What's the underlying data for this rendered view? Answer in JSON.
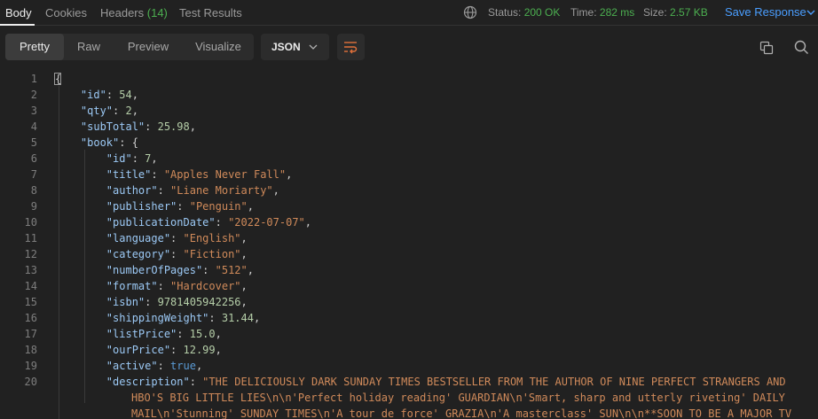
{
  "tabs": {
    "body": "Body",
    "cookies": "Cookies",
    "headers": "Headers",
    "headers_count": "(14)",
    "test_results": "Test Results"
  },
  "status": {
    "status_label": "Status:",
    "status_value": "200 OK",
    "time_label": "Time:",
    "time_value": "282 ms",
    "size_label": "Size:",
    "size_value": "2.57 KB"
  },
  "save_response": "Save Response",
  "views": {
    "pretty": "Pretty",
    "raw": "Raw",
    "preview": "Preview",
    "visualize": "Visualize"
  },
  "format": "JSON",
  "icons": {
    "globe": "globe-icon",
    "chevron": "chevron-down-icon",
    "wrap": "wrap-lines-icon",
    "copy": "copy-icon",
    "search": "search-icon"
  },
  "colors": {
    "accent": "#4a9eff",
    "success": "#4caf50",
    "key": "#9cc9f5",
    "string": "#d08a5a",
    "number": "#b5cea8",
    "boolean": "#5a9bd5"
  },
  "code": {
    "line_numbers": [
      "1",
      "2",
      "3",
      "4",
      "5",
      "6",
      "7",
      "8",
      "9",
      "10",
      "11",
      "12",
      "13",
      "14",
      "15",
      "16",
      "17",
      "18",
      "19",
      "20"
    ],
    "lines": [
      {
        "indent": "",
        "open": "{"
      },
      {
        "indent": "    ",
        "key": "\"id\"",
        "value": "54",
        "type": "n",
        "comma": ","
      },
      {
        "indent": "    ",
        "key": "\"qty\"",
        "value": "2",
        "type": "n",
        "comma": ","
      },
      {
        "indent": "    ",
        "key": "\"subTotal\"",
        "value": "25.98",
        "type": "n",
        "comma": ","
      },
      {
        "indent": "    ",
        "key": "\"book\"",
        "open": "{"
      },
      {
        "indent": "        ",
        "key": "\"id\"",
        "value": "7",
        "type": "n",
        "comma": ","
      },
      {
        "indent": "        ",
        "key": "\"title\"",
        "value": "\"Apples Never Fall\"",
        "type": "s",
        "comma": ","
      },
      {
        "indent": "        ",
        "key": "\"author\"",
        "value": "\"Liane Moriarty\"",
        "type": "s",
        "comma": ","
      },
      {
        "indent": "        ",
        "key": "\"publisher\"",
        "value": "\"Penguin\"",
        "type": "s",
        "comma": ","
      },
      {
        "indent": "        ",
        "key": "\"publicationDate\"",
        "value": "\"2022-07-07\"",
        "type": "s",
        "comma": ","
      },
      {
        "indent": "        ",
        "key": "\"language\"",
        "value": "\"English\"",
        "type": "s",
        "comma": ","
      },
      {
        "indent": "        ",
        "key": "\"category\"",
        "value": "\"Fiction\"",
        "type": "s",
        "comma": ","
      },
      {
        "indent": "        ",
        "key": "\"numberOfPages\"",
        "value": "\"512\"",
        "type": "s",
        "comma": ","
      },
      {
        "indent": "        ",
        "key": "\"format\"",
        "value": "\"Hardcover\"",
        "type": "s",
        "comma": ","
      },
      {
        "indent": "        ",
        "key": "\"isbn\"",
        "value": "9781405942256",
        "type": "n",
        "comma": ","
      },
      {
        "indent": "        ",
        "key": "\"shippingWeight\"",
        "value": "31.44",
        "type": "n",
        "comma": ","
      },
      {
        "indent": "        ",
        "key": "\"listPrice\"",
        "value": "15.0",
        "type": "n",
        "comma": ","
      },
      {
        "indent": "        ",
        "key": "\"ourPrice\"",
        "value": "12.99",
        "type": "n",
        "comma": ","
      },
      {
        "indent": "        ",
        "key": "\"active\"",
        "value": "true",
        "type": "b",
        "comma": ","
      },
      {
        "indent": "        ",
        "key": "\"description\"",
        "value": "\"THE DELICIOUSLY DARK SUNDAY TIMES BESTSELLER FROM THE AUTHOR OF NINE PERFECT STRANGERS AND",
        "type": "s",
        "comma": ""
      }
    ],
    "continuation": [
      "HBO'S BIG LITTLE LIES\\n\\n'Perfect holiday reading' GUARDIAN\\n'Smart, sharp and utterly riveting' DAILY",
      "MAIL\\n'Stunning' SUNDAY TIMES\\n'A tour de force' GRAZIA\\n'A masterclass' SUN\\n\\n**SOON TO BE A MAJOR TV"
    ]
  }
}
